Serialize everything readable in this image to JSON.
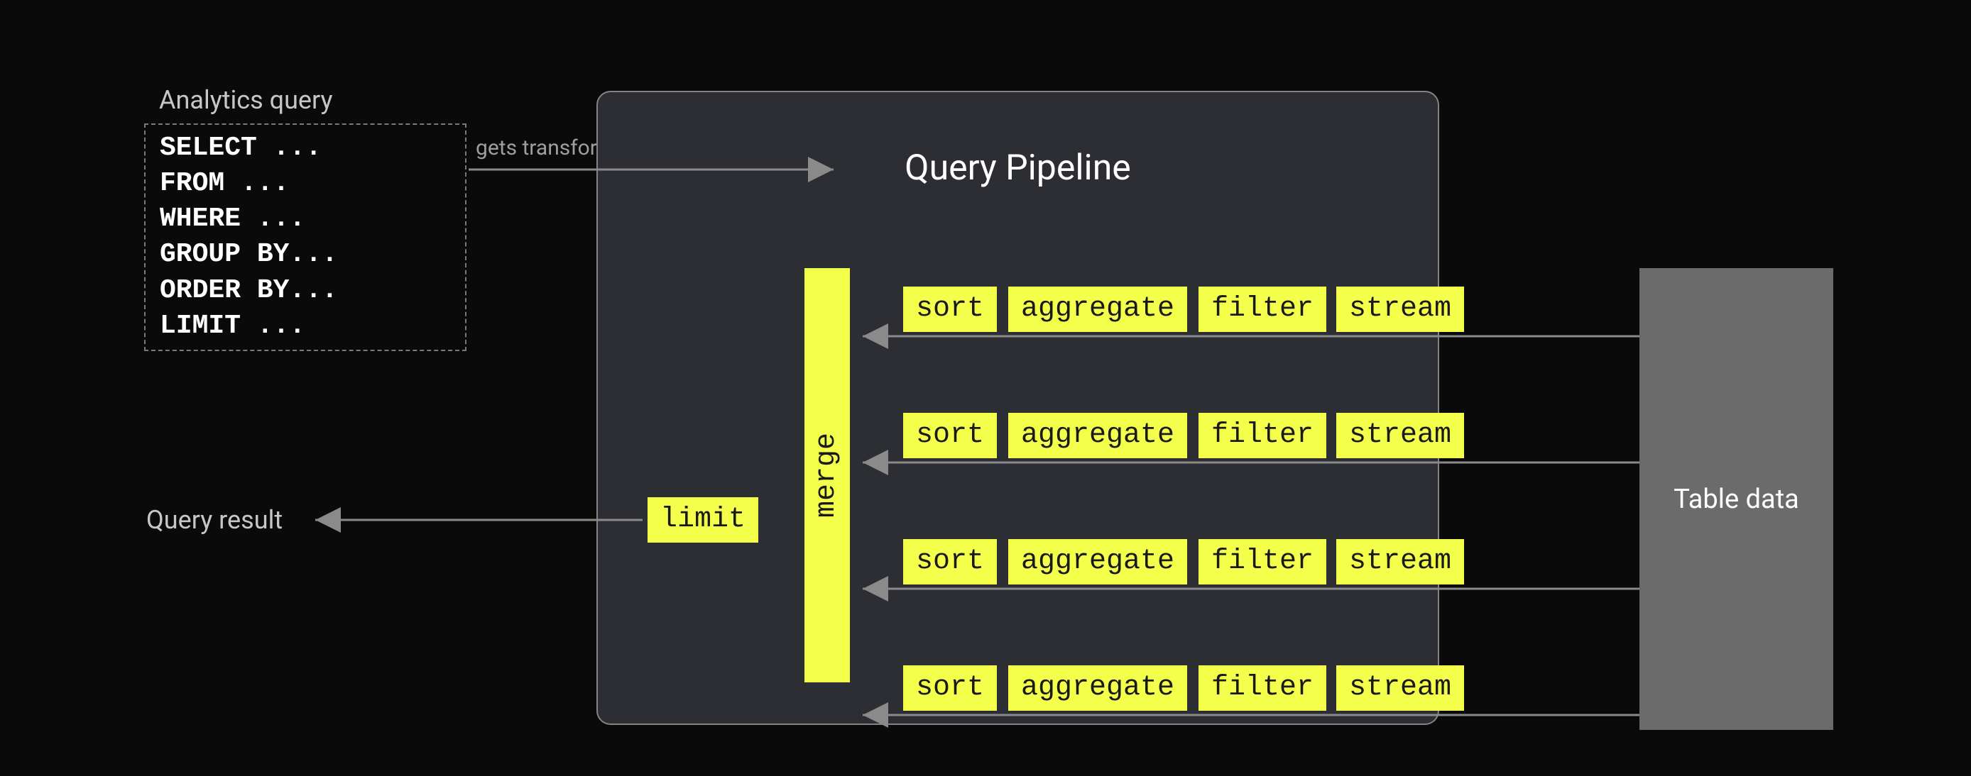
{
  "input": {
    "title": "Analytics query",
    "code": "SELECT ...\nFROM ...\nWHERE ...\nGROUP BY...\nORDER BY...\nLIMIT ..."
  },
  "transform_label": "gets transformed into",
  "pipeline": {
    "title": "Query Pipeline",
    "limit": "limit",
    "merge": "merge",
    "lanes": [
      [
        "sort",
        "aggregate",
        "filter",
        "stream"
      ],
      [
        "sort",
        "aggregate",
        "filter",
        "stream"
      ],
      [
        "sort",
        "aggregate",
        "filter",
        "stream"
      ],
      [
        "sort",
        "aggregate",
        "filter",
        "stream"
      ]
    ]
  },
  "source_block": "Table data",
  "output_label": "Query result",
  "colors": {
    "bg": "#0a0a0a",
    "panel": "#2c2e33",
    "panel_border": "#848484",
    "op": "#f4ff4b",
    "op_text": "#1a1a1a",
    "source": "#6b6b6b",
    "arrow": "#8a8a8a",
    "text": "#ffffff",
    "muted": "#c7c7c7"
  }
}
